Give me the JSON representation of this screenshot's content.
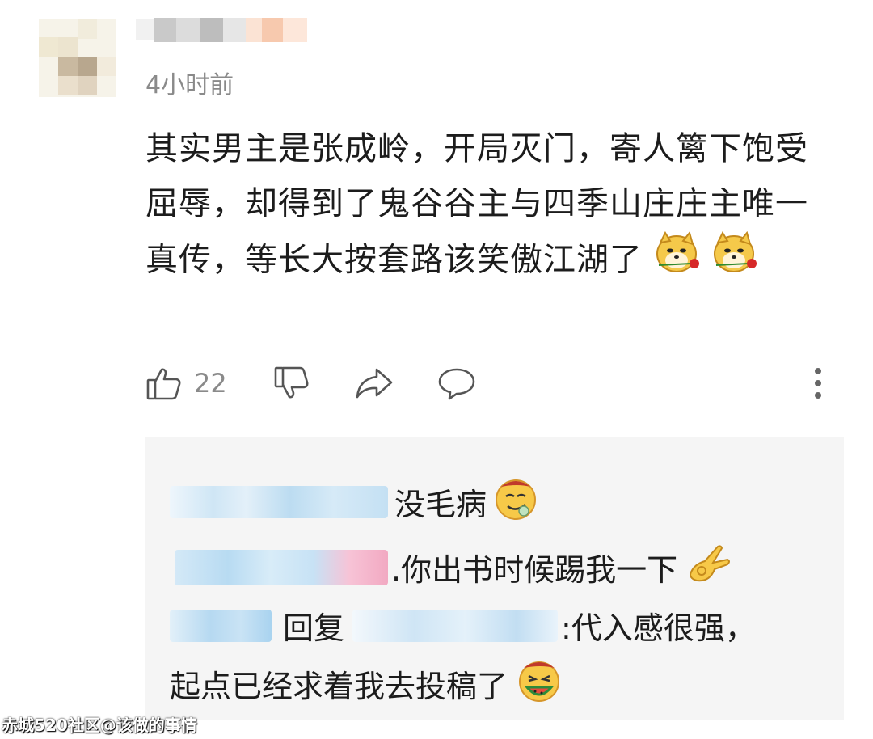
{
  "comment": {
    "time": "4小时前",
    "text": "其实男主是张成岭，开局灭门，寄人篱下饱受屈辱，却得到了鬼谷谷主与四季山庄庄主唯一真传，等长大按套路该笑傲江湖了",
    "likes": "22",
    "icons": [
      "thumbs-up-icon",
      "thumbs-down-icon",
      "share-icon",
      "comment-icon",
      "more-icon"
    ]
  },
  "replies": [
    {
      "text": "没毛病",
      "emoji": "smug-emoji"
    },
    {
      "text": ".你出书时候踢我一下",
      "emoji": "ok-hand-emoji"
    },
    {
      "reply_word": "回复",
      "text": ":代入感很强，",
      "text2": "起点已经求着我去投稿了",
      "emoji": "watermelon-emoji"
    }
  ],
  "watermark": "赤城520社区@该做的事情",
  "colors": {
    "reply_bg": "#f5f5f5",
    "meta_gray": "#8a8a8a",
    "link_blue": "#a9d3ef"
  }
}
